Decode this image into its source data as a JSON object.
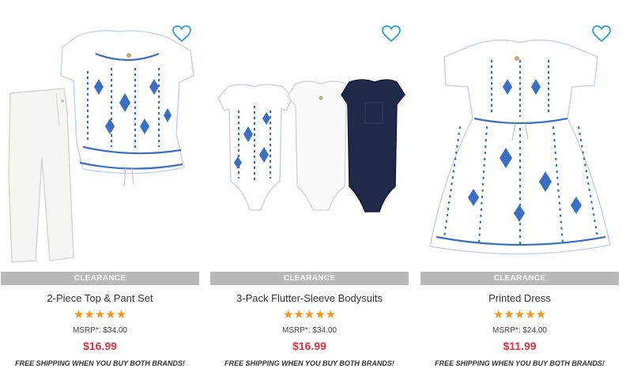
{
  "products": [
    {
      "name": "2-Piece Top & Pant Set",
      "badge": "CLEARANCE",
      "rating": "★★★★★",
      "msrp": "MSRP*: $34.00",
      "price": "$16.99",
      "shipping": "FREE SHIPPING WHEN YOU BUY BOTH BRANDS!",
      "icon": "heart-outline-icon"
    },
    {
      "name": "3-Pack Flutter-Sleeve Bodysuits",
      "badge": "CLEARANCE",
      "rating": "★★★★★",
      "msrp": "MSRP*: $34.00",
      "price": "$16.99",
      "shipping": "FREE SHIPPING WHEN YOU BUY BOTH BRANDS!",
      "icon": "heart-outline-icon"
    },
    {
      "name": "Printed Dress",
      "badge": "CLEARANCE",
      "rating": "★★★★★",
      "msrp": "MSRP*: $24.00",
      "price": "$11.99",
      "shipping": "FREE SHIPPING WHEN YOU BUY BOTH BRANDS!",
      "icon": "heart-outline-icon"
    }
  ],
  "colors": {
    "badge_bg": "#b9b9b9",
    "price": "#e4303a",
    "stars": "#f7941d",
    "heart": "#2a9fd8",
    "print_blue": "#3a6fc4",
    "navy": "#1f2a4a"
  }
}
